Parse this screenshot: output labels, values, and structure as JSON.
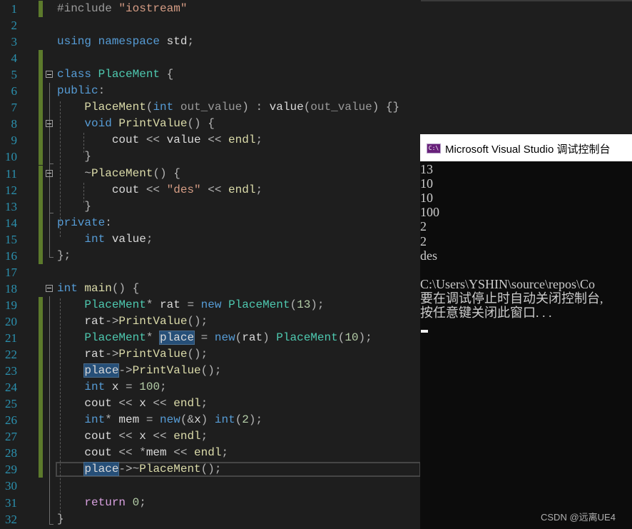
{
  "editor": {
    "lines": [
      {
        "n": "1",
        "tokens": [
          [
            "pp",
            "#include "
          ],
          [
            "str",
            "\"iostream\""
          ]
        ]
      },
      {
        "n": "2",
        "tokens": []
      },
      {
        "n": "3",
        "tokens": [
          [
            "kw",
            "using namespace "
          ],
          [
            "var",
            "std"
          ],
          [
            "pn",
            ";"
          ]
        ]
      },
      {
        "n": "4",
        "tokens": []
      },
      {
        "n": "5",
        "tokens": [
          [
            "kw",
            "class "
          ],
          [
            "ty",
            "PlaceMent"
          ],
          [
            "pn",
            " {"
          ]
        ]
      },
      {
        "n": "6",
        "tokens": [
          [
            "kw",
            "public"
          ],
          [
            "pn",
            ":"
          ]
        ]
      },
      {
        "n": "7",
        "tokens": [
          [
            "pn",
            "    "
          ],
          [
            "fn",
            "PlaceMent"
          ],
          [
            "pn",
            "("
          ],
          [
            "kw",
            "int "
          ],
          [
            "prm",
            "out_value"
          ],
          [
            "pn",
            ") : "
          ],
          [
            "mem",
            "value"
          ],
          [
            "pn",
            "("
          ],
          [
            "prm",
            "out_value"
          ],
          [
            "pn",
            ") {}"
          ]
        ]
      },
      {
        "n": "8",
        "tokens": [
          [
            "pn",
            "    "
          ],
          [
            "kw",
            "void "
          ],
          [
            "fn",
            "PrintValue"
          ],
          [
            "pn",
            "() {"
          ]
        ]
      },
      {
        "n": "9",
        "tokens": [
          [
            "pn",
            "        "
          ],
          [
            "var",
            "cout"
          ],
          [
            "pn",
            " << "
          ],
          [
            "mem",
            "value"
          ],
          [
            "pn",
            " << "
          ],
          [
            "fn",
            "endl"
          ],
          [
            "pn",
            ";"
          ]
        ]
      },
      {
        "n": "10",
        "tokens": [
          [
            "pn",
            "    }"
          ]
        ]
      },
      {
        "n": "11",
        "tokens": [
          [
            "pn",
            "    ~"
          ],
          [
            "fn",
            "PlaceMent"
          ],
          [
            "pn",
            "() {"
          ]
        ]
      },
      {
        "n": "12",
        "tokens": [
          [
            "pn",
            "        "
          ],
          [
            "var",
            "cout"
          ],
          [
            "pn",
            " << "
          ],
          [
            "str",
            "\"des\""
          ],
          [
            "pn",
            " << "
          ],
          [
            "fn",
            "endl"
          ],
          [
            "pn",
            ";"
          ]
        ]
      },
      {
        "n": "13",
        "tokens": [
          [
            "pn",
            "    }"
          ]
        ]
      },
      {
        "n": "14",
        "tokens": [
          [
            "kw",
            "private"
          ],
          [
            "pn",
            ":"
          ]
        ]
      },
      {
        "n": "15",
        "tokens": [
          [
            "pn",
            "    "
          ],
          [
            "kw",
            "int "
          ],
          [
            "mem",
            "value"
          ],
          [
            "pn",
            ";"
          ]
        ]
      },
      {
        "n": "16",
        "tokens": [
          [
            "pn",
            "};"
          ]
        ]
      },
      {
        "n": "17",
        "tokens": []
      },
      {
        "n": "18",
        "tokens": [
          [
            "kw",
            "int "
          ],
          [
            "fn",
            "main"
          ],
          [
            "pn",
            "() {"
          ]
        ]
      },
      {
        "n": "19",
        "tokens": [
          [
            "pn",
            "    "
          ],
          [
            "ty",
            "PlaceMent"
          ],
          [
            "pn",
            "* "
          ],
          [
            "var",
            "rat"
          ],
          [
            "pn",
            " = "
          ],
          [
            "kw",
            "new "
          ],
          [
            "ty",
            "PlaceMent"
          ],
          [
            "pn",
            "("
          ],
          [
            "num",
            "13"
          ],
          [
            "pn",
            ");"
          ]
        ]
      },
      {
        "n": "20",
        "tokens": [
          [
            "pn",
            "    "
          ],
          [
            "var",
            "rat"
          ],
          [
            "pn",
            "->"
          ],
          [
            "fn",
            "PrintValue"
          ],
          [
            "pn",
            "();"
          ]
        ]
      },
      {
        "n": "21",
        "tokens": [
          [
            "pn",
            "    "
          ],
          [
            "ty",
            "PlaceMent"
          ],
          [
            "pn",
            "* "
          ],
          [
            "hl",
            "place"
          ],
          [
            "pn",
            " = "
          ],
          [
            "kw",
            "new"
          ],
          [
            "pn",
            "("
          ],
          [
            "var",
            "rat"
          ],
          [
            "pn",
            ") "
          ],
          [
            "ty",
            "PlaceMent"
          ],
          [
            "pn",
            "("
          ],
          [
            "num",
            "10"
          ],
          [
            "pn",
            ");"
          ]
        ]
      },
      {
        "n": "22",
        "tokens": [
          [
            "pn",
            "    "
          ],
          [
            "var",
            "rat"
          ],
          [
            "pn",
            "->"
          ],
          [
            "fn",
            "PrintValue"
          ],
          [
            "pn",
            "();"
          ]
        ]
      },
      {
        "n": "23",
        "tokens": [
          [
            "pn",
            "    "
          ],
          [
            "hl",
            "place"
          ],
          [
            "pn",
            "->"
          ],
          [
            "fn",
            "PrintValue"
          ],
          [
            "pn",
            "();"
          ]
        ]
      },
      {
        "n": "24",
        "tokens": [
          [
            "pn",
            "    "
          ],
          [
            "kw",
            "int "
          ],
          [
            "var",
            "x"
          ],
          [
            "pn",
            " = "
          ],
          [
            "num",
            "100"
          ],
          [
            "pn",
            ";"
          ]
        ]
      },
      {
        "n": "25",
        "tokens": [
          [
            "pn",
            "    "
          ],
          [
            "var",
            "cout"
          ],
          [
            "pn",
            " << "
          ],
          [
            "var",
            "x"
          ],
          [
            "pn",
            " << "
          ],
          [
            "fn",
            "endl"
          ],
          [
            "pn",
            ";"
          ]
        ]
      },
      {
        "n": "26",
        "tokens": [
          [
            "pn",
            "    "
          ],
          [
            "kw",
            "int"
          ],
          [
            "pn",
            "* "
          ],
          [
            "var",
            "mem"
          ],
          [
            "pn",
            " = "
          ],
          [
            "kw",
            "new"
          ],
          [
            "pn",
            "(&"
          ],
          [
            "var",
            "x"
          ],
          [
            "pn",
            ") "
          ],
          [
            "kw",
            "int"
          ],
          [
            "pn",
            "("
          ],
          [
            "num",
            "2"
          ],
          [
            "pn",
            ");"
          ]
        ]
      },
      {
        "n": "27",
        "tokens": [
          [
            "pn",
            "    "
          ],
          [
            "var",
            "cout"
          ],
          [
            "pn",
            " << "
          ],
          [
            "var",
            "x"
          ],
          [
            "pn",
            " << "
          ],
          [
            "fn",
            "endl"
          ],
          [
            "pn",
            ";"
          ]
        ]
      },
      {
        "n": "28",
        "tokens": [
          [
            "pn",
            "    "
          ],
          [
            "var",
            "cout"
          ],
          [
            "pn",
            " << *"
          ],
          [
            "var",
            "mem"
          ],
          [
            "pn",
            " << "
          ],
          [
            "fn",
            "endl"
          ],
          [
            "pn",
            ";"
          ]
        ]
      },
      {
        "n": "29",
        "tokens": [
          [
            "pn",
            "    "
          ],
          [
            "hl",
            "place"
          ],
          [
            "pn",
            "->~"
          ],
          [
            "fn",
            "PlaceMent"
          ],
          [
            "pn",
            "();"
          ]
        ]
      },
      {
        "n": "30",
        "tokens": []
      },
      {
        "n": "31",
        "tokens": [
          [
            "pn",
            "    "
          ],
          [
            "ctl",
            "return "
          ],
          [
            "num",
            "0"
          ],
          [
            "pn",
            ";"
          ]
        ]
      },
      {
        "n": "32",
        "tokens": [
          [
            "pn",
            "}"
          ]
        ]
      }
    ],
    "changed_lines": [
      1,
      4,
      5,
      6,
      7,
      8,
      9,
      10,
      11,
      12,
      13,
      14,
      15,
      16,
      19,
      20,
      21,
      22,
      23,
      24,
      25,
      26,
      27,
      28,
      29
    ],
    "fold_lines": [
      5,
      8,
      11,
      18
    ]
  },
  "console": {
    "icon": "console-app-icon",
    "icon_text": "C:\\",
    "title": "Microsoft Visual Studio 调试控制台",
    "output_lines": [
      "13",
      "10",
      "10",
      "100",
      "2",
      "2",
      "des",
      "",
      "C:\\Users\\YSHIN\\source\\repos\\Co",
      "要在调试停止时自动关闭控制台,",
      "按任意键关闭此窗口. . ."
    ]
  },
  "watermark": "CSDN @远离UE4"
}
